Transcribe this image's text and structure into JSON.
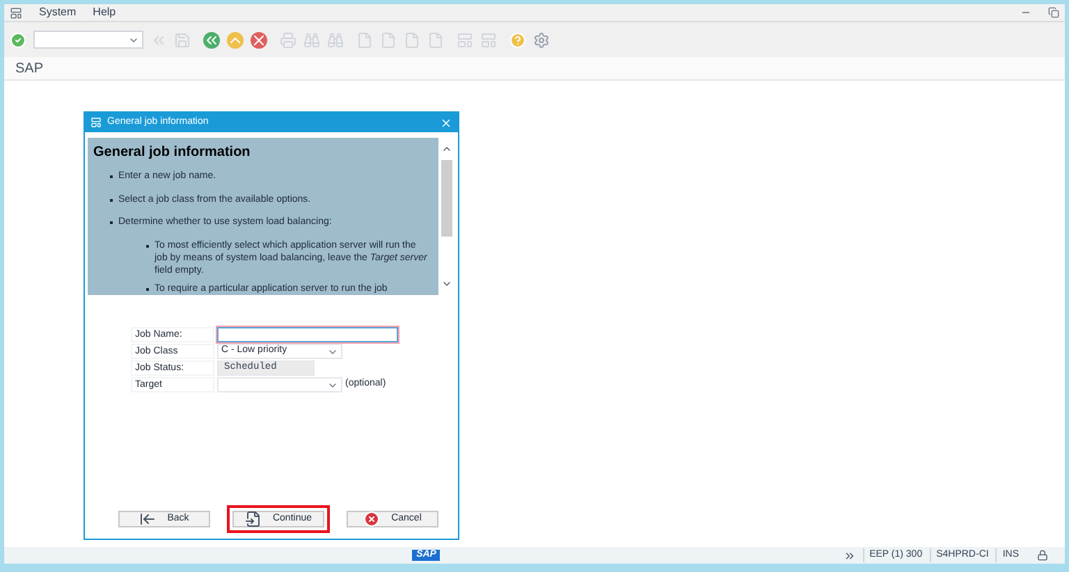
{
  "menu": [
    "System",
    "Help"
  ],
  "title": "SAP",
  "dialog": {
    "title": "General job information",
    "help_heading": "General job information",
    "help_items": [
      {
        "text": "Enter a new job name."
      },
      {
        "text": "Select a job class from the available options."
      },
      {
        "text": "Determine whether to use system load balancing:",
        "children": [
          {
            "text": "To most efficiently select which application server will run the job by means of system load balancing, leave the *Target server* field empty."
          },
          {
            "text": "To require a particular application server to run the job"
          }
        ]
      }
    ],
    "fields": [
      {
        "label": "Job Name:",
        "kind": "text",
        "focused": true
      },
      {
        "label": "Job Class",
        "kind": "dropdown",
        "value": "C - Low priority"
      },
      {
        "label": "Job Status:",
        "kind": "readonly",
        "value": "Scheduled"
      },
      {
        "label": "Target",
        "kind": "dropdown",
        "note": "(optional)"
      }
    ],
    "buttons": [
      {
        "label": "Back",
        "kind": "back",
        "highlighted": false
      },
      {
        "label": "Continue",
        "kind": "continue",
        "highlighted": true
      },
      {
        "label": "Cancel",
        "kind": "cancel",
        "highlighted": false
      }
    ]
  },
  "status": {
    "logo": "SAP",
    "items": [
      "EEP (1) 300",
      "S4HPRD-CI",
      "INS"
    ]
  }
}
